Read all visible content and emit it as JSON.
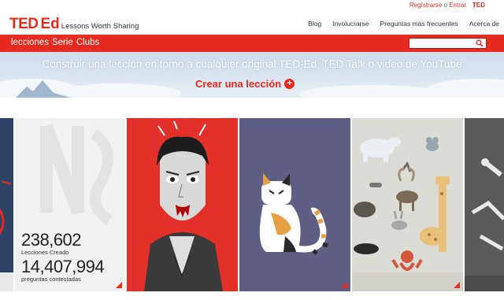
{
  "util": {
    "register": "Regístrarse",
    "or": "o",
    "login": "Entrar",
    "ted": "TED"
  },
  "header": {
    "logo_ted": "TED",
    "logo_ed": "Ed",
    "tagline": "Lessons Worth Sharing",
    "nav": [
      "Blog",
      "Involucrarse",
      "Preguntas más frecuentes",
      "Acerca de"
    ]
  },
  "subnav": {
    "tabs": [
      "lecciones",
      "Serie",
      "Clubs"
    ],
    "search_placeholder": ""
  },
  "hero": {
    "headline": "Construir una lección en torno a cualquier original TED-Ed, TED Talk o video de YouTube",
    "cta": "Crear una lección",
    "cta_icon": "+"
  },
  "stats": {
    "lessons_count": "238,602",
    "lessons_label": "Lecciones Creado",
    "answers_count": "14,407,994",
    "answers_label": "preguntas contestadas"
  },
  "gallery": {
    "tiles": [
      "partial-blue",
      "stats-panel",
      "vampire",
      "calico-cat",
      "animals",
      "partial-skeleton"
    ]
  },
  "colors": {
    "accent": "#e62b1e",
    "hero_bg": "#d6e1ec"
  }
}
